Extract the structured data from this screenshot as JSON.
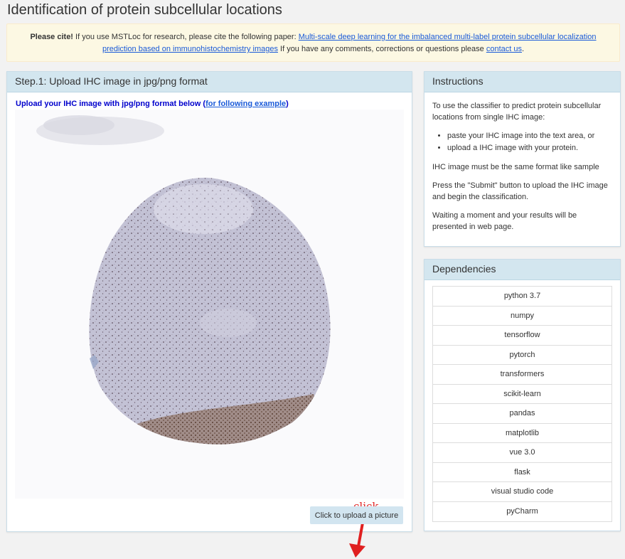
{
  "page_title": "Identification of protein subcellular locations",
  "citation": {
    "bold_lead": "Please cite!",
    "text_before_link": " If you use MSTLoc for research, please cite the following paper: ",
    "paper_link": "Multi-scale deep learning for the imbalanced multi-label protein subcellular localization prediction based on immunohistochemistry images",
    "text_after_link": " If you have any comments, corrections or questions please ",
    "contact_link": "contact us",
    "trailing": "."
  },
  "upload_panel": {
    "heading": "Step.1: Upload IHC image in jpg/png format",
    "hint_text": "Upload your IHC image with jpg/png format below (",
    "hint_link": "for following example",
    "hint_close": ")",
    "upload_button": "Click to upload a picture",
    "annotation": "click"
  },
  "instructions_panel": {
    "heading": "Instructions",
    "intro": "To use the classifier to predict protein subcellular locations from single IHC image:",
    "bullets": [
      "paste your IHC image into the text area, or",
      "upload a IHC image with your protein."
    ],
    "note": "IHC image must be the same format like sample",
    "submit_info": "Press the \"Submit\" button to upload the IHC image and begin the classification.",
    "wait_info": "Waiting a moment and your results will be presented in web page."
  },
  "dependencies_panel": {
    "heading": "Dependencies",
    "items": [
      "python 3.7",
      "numpy",
      "tensorflow",
      "pytorch",
      "transformers",
      "scikit-learn",
      "pandas",
      "matplotlib",
      "vue 3.0",
      "flask",
      "visual studio code",
      "pyCharm"
    ]
  },
  "colors": {
    "panel_heading": "#d3e6ef",
    "cite_background": "#fcf8e3",
    "hint_text": "#0000cc",
    "annotation": "#e02020",
    "tissue": "#b8b8cc"
  }
}
